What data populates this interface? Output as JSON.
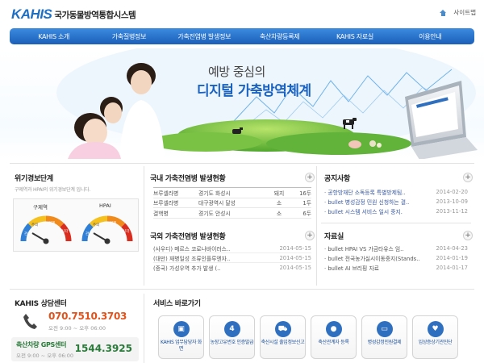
{
  "header": {
    "brand": "KAHIS",
    "brand_sub": "국가동물방역통합시스템",
    "sitemap": "사이트맵"
  },
  "nav": [
    "KAHIS 소개",
    "가축질병정보",
    "가축전염병 발생정보",
    "축산차량등록제",
    "KAHIS 자료실",
    "이용안내"
  ],
  "hero": {
    "line1": "예방 중심의",
    "line2": "디지털 가축방역체계"
  },
  "alert": {
    "title": "위기경보단계",
    "desc": "구제역과 HPAI의 위기경보단계 입니다.",
    "gauges": [
      {
        "name": "구제역",
        "labels": [
          "관심",
          "주의",
          "경계",
          "심각"
        ],
        "level": 0.2
      },
      {
        "name": "HPAI",
        "labels": [
          "관심",
          "주의",
          "경계",
          "심각"
        ],
        "level": 0.2
      }
    ]
  },
  "domestic": {
    "title": "국내 가축전염병 발생현황",
    "rows": [
      [
        "브루셀라병",
        "경기도 화성시",
        "돼지",
        "16두"
      ],
      [
        "브루셀라병",
        "대구광역시 달성",
        "소",
        "1두"
      ],
      [
        "결핵병",
        "경기도 안성시",
        "소",
        "6두"
      ]
    ]
  },
  "overseas": {
    "title": "국외 가축전염병 발생현황",
    "rows": [
      [
        "(사우디) 메르스 코로나바이러스..",
        "2014-05-15"
      ],
      [
        "(대만) 재병일성 조류인플루엔자..",
        "2014-05-15"
      ],
      [
        "(중국) 가성우역 추가 발생 (..",
        "2014-05-15"
      ]
    ]
  },
  "notice": {
    "title": "공지사항",
    "rows": [
      [
        "공항방재단 소독등록 특별방제팀..",
        "2014-02-20"
      ],
      [
        "bullet 병성감정 민원 신청하는 결..",
        "2013-10-09"
      ],
      [
        "bullet 시스템 서비스 일시 중지.",
        "2013-11-12"
      ]
    ]
  },
  "library": {
    "title": "자료실",
    "rows": [
      [
        "bullet HPAI VS 가금타유스 임..",
        "2014-04-23"
      ],
      [
        "bullet 전국농가실시이동중지(Stands..",
        "2014-01-19"
      ],
      [
        "bullet AI 브리핑 자료",
        "2014-01-17"
      ]
    ]
  },
  "contact": {
    "title": "KAHIS 상담센터",
    "phone": "070.7510.3703",
    "hours": "오전 9:00 ~ 오후 06:00",
    "gps_title": "축산차량 GPS센터",
    "gps_hours": "오전 9:00 ~ 오후 06:00",
    "gps_phone": "1544.3925"
  },
  "services": {
    "title": "서비스 바로가기",
    "items": [
      {
        "label": "KAHIS 업무담당자 화면",
        "icon": "monitor-icon",
        "glyph": "▣"
      },
      {
        "label": "농장고유번호 인증발급",
        "icon": "number-4-icon",
        "glyph": "4"
      },
      {
        "label": "축산시설 출입정보신고",
        "icon": "truck-icon",
        "glyph": "⛟"
      },
      {
        "label": "축산관계자 등록",
        "icon": "person-icon",
        "glyph": "●"
      },
      {
        "label": "병성감정민원결제",
        "icon": "card-icon",
        "glyph": "▭"
      },
      {
        "label": "임상증상기관진단",
        "icon": "heart-plus-icon",
        "glyph": "♥"
      }
    ]
  },
  "colors": {
    "accent": "#1c5fb8",
    "phone": "#e0541c",
    "link": "#3a5aa0"
  }
}
